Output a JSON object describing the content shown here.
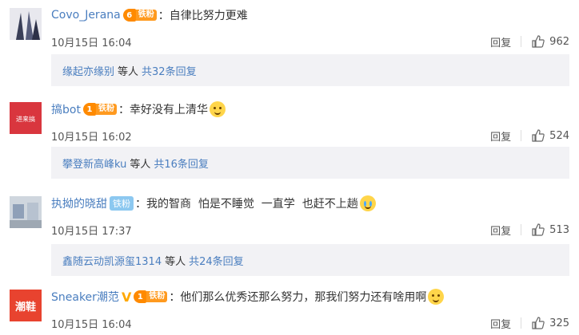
{
  "comments": [
    {
      "username": "Covo_Jerana",
      "badge_level": "6",
      "badge_label": "铁粉",
      "colon": "：",
      "text": "自律比努力更难",
      "time": "10月15日 16:04",
      "reply_label": "回复",
      "likes": "962",
      "avatar_icon": "avatar-photo",
      "sub": {
        "name": "缘起亦缘别",
        "mid": "等人",
        "link": "共32条回复"
      }
    },
    {
      "username": "搞bot",
      "badge_level": "1",
      "badge_label": "铁粉",
      "colon": "：",
      "text": "幸好没有上清华",
      "time": "10月15日 16:02",
      "reply_label": "回复",
      "likes": "524",
      "avatar_text": "进来搞",
      "avatar_color": "#d9363e",
      "sub": {
        "name": "攀登新高峰ku",
        "mid": "等人",
        "link": "共16条回复"
      }
    },
    {
      "username": "执拗的晓甜",
      "badge_label": "铁粉",
      "colon": "：",
      "text": "我的智商  怕是不睡觉  一直学  也赶不上趟",
      "time": "10月15日 17:37",
      "reply_label": "回复",
      "likes": "513",
      "avatar_icon": "avatar-photo",
      "sub": {
        "name": "鑫随云动凯源玺1314",
        "mid": "等人",
        "link": "共24条回复"
      }
    },
    {
      "username": "Sneaker潮范",
      "badge_level": "1",
      "badge_label": "铁粉",
      "colon": "：",
      "text": "他们那么优秀还那么努力，那我们努力还有啥用啊",
      "time": "10月15日 16:04",
      "reply_label": "回复",
      "likes": "325",
      "avatar_text": "潮鞋",
      "avatar_color": "#e8432f"
    }
  ],
  "colors": {
    "link": "#4a7ebf",
    "sub_bg": "#f2f2f5",
    "badge_orange": "#ff8a00",
    "badge_blue": "#8cc8f0"
  }
}
